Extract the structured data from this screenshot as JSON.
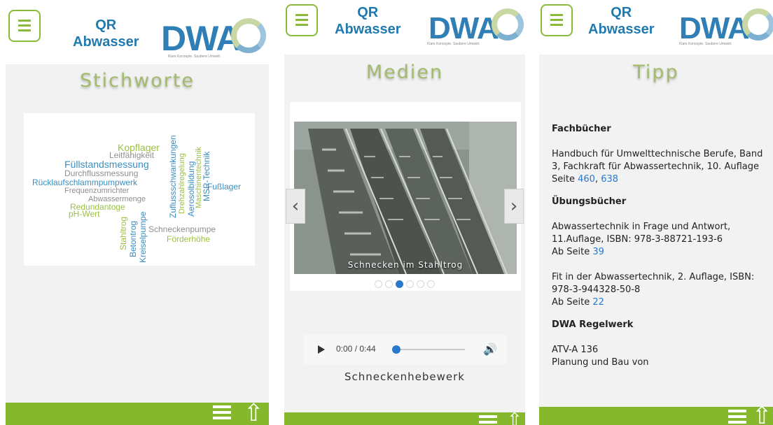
{
  "app": {
    "title_line1": "QR",
    "title_line2": "Abwasser",
    "logo_text": "DWA",
    "logo_tagline": "Klare Konzepte. Saubere Umwelt."
  },
  "colors": {
    "brand_green": "#85b82d",
    "brand_blue": "#2f7fb6",
    "title_green": "#a2bb6c",
    "link_blue": "#2a78c9"
  },
  "icons": {
    "menu": "hamburger-icon",
    "scroll_top": "arrow-up-icon",
    "prev": "chevron-left-icon",
    "next": "chevron-right-icon",
    "play": "play-icon",
    "volume": "volume-icon"
  },
  "screens": {
    "stichworte": {
      "title": "Stichworte",
      "words": [
        {
          "text": "Kopflager",
          "color": "#9bbf45"
        },
        {
          "text": "Leitfähigkeit",
          "color": "#8f8f8f"
        },
        {
          "text": "Füllstandsmessung",
          "color": "#3a8ec0"
        },
        {
          "text": "Durchflussmessung",
          "color": "#8f8f8f"
        },
        {
          "text": "Rücklaufschlammpumpwerk",
          "color": "#3a8ec0"
        },
        {
          "text": "Frequenzumrichter",
          "color": "#8f8f8f"
        },
        {
          "text": "Abwassermenge",
          "color": "#8f8f8f"
        },
        {
          "text": "Redundantoge",
          "color": "#9bbf45"
        },
        {
          "text": "pH-Wert",
          "color": "#9bbf45"
        },
        {
          "text": "Fußlager",
          "color": "#3a8ec0"
        },
        {
          "text": "Schneckenpumpe",
          "color": "#8f8f8f"
        },
        {
          "text": "Förderhöhe",
          "color": "#9bbf45"
        },
        {
          "text": "Zuflussschwankungen",
          "color": "#3a8ec0"
        },
        {
          "text": "Drehzahlregelung",
          "color": "#9bbf45"
        },
        {
          "text": "Aerosolbildung",
          "color": "#3a8ec0"
        },
        {
          "text": "Maschinentechnik",
          "color": "#9bbf45"
        },
        {
          "text": "MSR-Technik",
          "color": "#3a8ec0"
        },
        {
          "text": "Stahltrog",
          "color": "#9bbf45"
        },
        {
          "text": "Betontrog",
          "color": "#3a8ec0"
        },
        {
          "text": "Kreiselpumpe",
          "color": "#3a8ec0"
        }
      ]
    },
    "medien": {
      "title": "Medien",
      "slide_caption": "Schnecken im Stahltrog",
      "slide_count": 6,
      "active_slide": 3,
      "audio": {
        "current": "0:00",
        "duration": "0:44",
        "time_display": "0:00 / 0:44",
        "progress": 0.0,
        "title": "Schneckenhebewerk"
      }
    },
    "tipp": {
      "title": "Tipp",
      "sections": [
        {
          "heading": "Fachbücher",
          "entries": [
            {
              "text": "Handbuch für Umwelttechnische Berufe, Band 3, Fachkraft für Abwassertechnik, 10. Auflage",
              "pages_prefix": "Seite",
              "pages": [
                "460",
                "638"
              ]
            }
          ]
        },
        {
          "heading": "Übungsbücher",
          "entries": [
            {
              "text": "Abwassertechnik in Frage und Antwort, 11.Auflage, ISBN: 978-3-88721-193-6",
              "pages_prefix": "Ab Seite",
              "pages": [
                "39"
              ]
            },
            {
              "text": "Fit in der Abwassertechnik, 2. Auflage, ISBN: 978-3-944328-50-8",
              "pages_prefix": "Ab Seite",
              "pages": [
                "22"
              ]
            }
          ]
        },
        {
          "heading": "DWA Regelwerk",
          "entries": [
            {
              "text": "ATV-A 136",
              "pages_prefix": "",
              "pages": []
            }
          ]
        }
      ],
      "cutoff_text": "Planung und Bau von"
    }
  }
}
